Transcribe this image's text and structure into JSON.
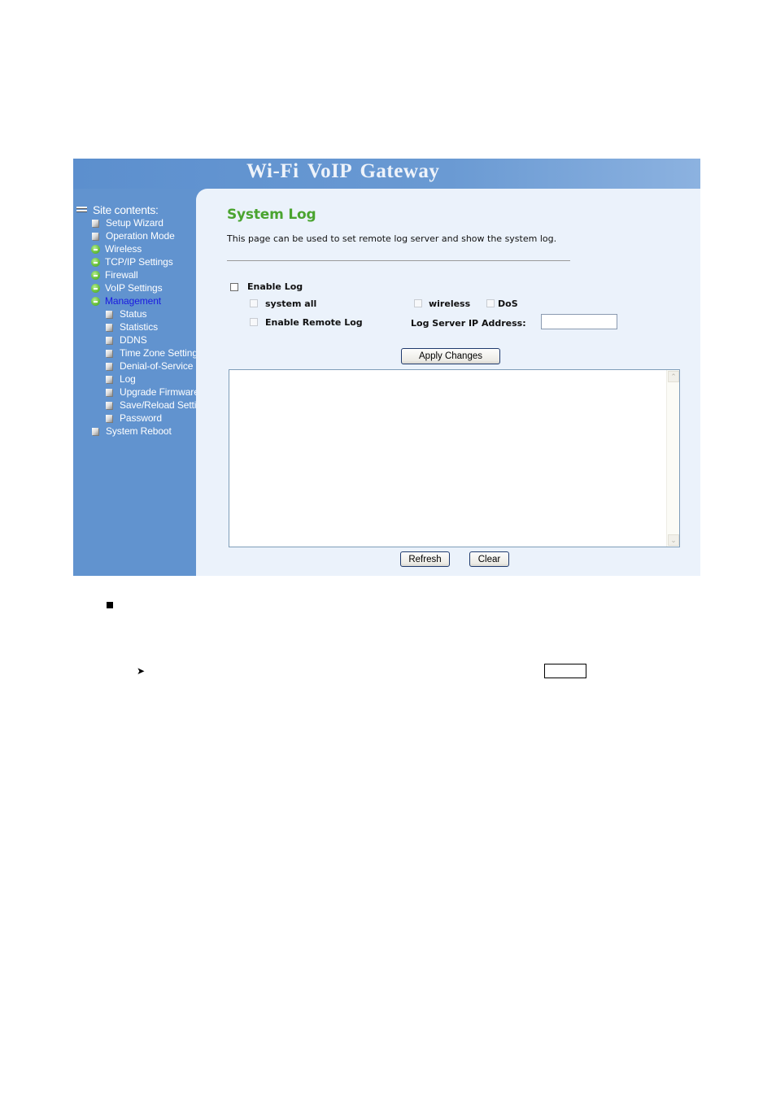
{
  "app": {
    "banner_title": "Wi-Fi  VoIP  Gateway"
  },
  "sidebar": {
    "root_label": "Site contents:",
    "root_icon": "tree-root-icon",
    "items": [
      {
        "label": "Setup Wizard",
        "icon": "page-icon",
        "level": 1
      },
      {
        "label": "Operation Mode",
        "icon": "page-icon",
        "level": 1
      },
      {
        "label": "Wireless",
        "icon": "folder-icon",
        "level": 1
      },
      {
        "label": "TCP/IP Settings",
        "icon": "folder-icon",
        "level": 1
      },
      {
        "label": "Firewall",
        "icon": "folder-icon",
        "level": 1
      },
      {
        "label": "VoIP Settings",
        "icon": "folder-icon",
        "level": 1
      },
      {
        "label": "Management",
        "icon": "folder-icon",
        "level": 1,
        "active": true
      },
      {
        "label": "Status",
        "icon": "page-icon",
        "level": 2
      },
      {
        "label": "Statistics",
        "icon": "page-icon",
        "level": 2
      },
      {
        "label": "DDNS",
        "icon": "page-icon",
        "level": 2
      },
      {
        "label": "Time Zone Setting",
        "icon": "page-icon",
        "level": 2
      },
      {
        "label": "Denial-of-Service",
        "icon": "page-icon",
        "level": 2
      },
      {
        "label": "Log",
        "icon": "page-icon",
        "level": 2
      },
      {
        "label": "Upgrade Firmware",
        "icon": "page-icon",
        "level": 2
      },
      {
        "label": "Save/Reload Settings",
        "icon": "page-icon",
        "level": 2
      },
      {
        "label": "Password",
        "icon": "page-icon",
        "level": 2
      },
      {
        "label": "System Reboot",
        "icon": "page-icon",
        "level": 1
      }
    ]
  },
  "main": {
    "title": "System Log",
    "description": "This page can be used to set remote log server and show the system log.",
    "enable_log": {
      "label": "Enable Log",
      "checked": false
    },
    "system_all": {
      "label": "system all",
      "checked": false,
      "disabled": true
    },
    "wireless": {
      "label": "wireless",
      "checked": false,
      "disabled": true
    },
    "dos": {
      "label": "DoS",
      "checked": false,
      "disabled": true
    },
    "enable_remote_log": {
      "label": "Enable Remote Log",
      "checked": false,
      "disabled": true
    },
    "log_server_ip": {
      "label": "Log Server IP Address:",
      "value": "",
      "placeholder": ""
    },
    "apply_label": "Apply Changes",
    "log_text": "",
    "refresh_label": "Refresh",
    "clear_label": "Clear"
  },
  "colors": {
    "sidebar_bg": "#6193cf",
    "content_bg": "#ebf2fb",
    "title_green": "#4aa42f",
    "active_link": "#1a1ae0"
  },
  "document": {
    "bullet_icon": "square-bullet-icon",
    "arrow_icon": "arrowhead-bullet-icon"
  }
}
